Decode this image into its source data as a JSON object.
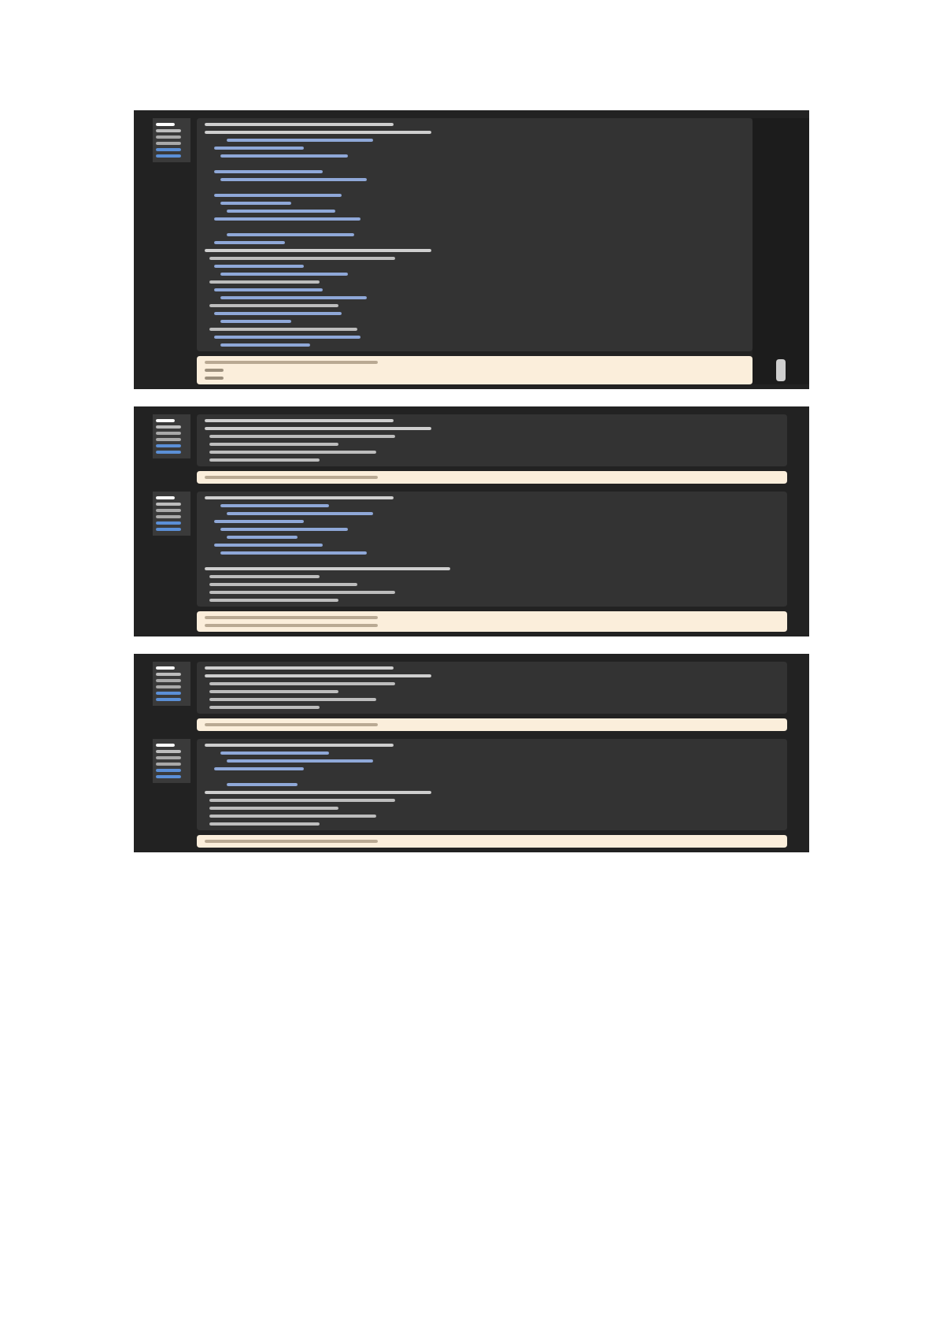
{
  "screenshots": [
    {
      "scrollbar": true,
      "questions": [
        {
          "info": [
            {
              "kind": "title"
            },
            {
              "kind": "status"
            },
            {
              "kind": "mark"
            },
            {
              "kind": "mark"
            },
            {
              "kind": "flag"
            },
            {
              "kind": "flag"
            }
          ],
          "lines": [
            {
              "kind": "text"
            },
            {
              "kind": "text"
            },
            {
              "kind": "code"
            },
            {
              "kind": "code"
            },
            {
              "kind": "code"
            },
            {
              "kind": "blank"
            },
            {
              "kind": "code"
            },
            {
              "kind": "code"
            },
            {
              "kind": "blank"
            },
            {
              "kind": "code"
            },
            {
              "kind": "code"
            },
            {
              "kind": "code"
            },
            {
              "kind": "code"
            },
            {
              "kind": "blank"
            },
            {
              "kind": "code"
            },
            {
              "kind": "code"
            },
            {
              "kind": "text"
            },
            {
              "kind": "option"
            },
            {
              "kind": "code"
            },
            {
              "kind": "code"
            },
            {
              "kind": "option"
            },
            {
              "kind": "code"
            },
            {
              "kind": "code"
            },
            {
              "kind": "option"
            },
            {
              "kind": "code"
            },
            {
              "kind": "code"
            },
            {
              "kind": "option"
            },
            {
              "kind": "code"
            },
            {
              "kind": "code"
            }
          ],
          "feedback": [
            {
              "kind": "text"
            },
            {
              "kind": "code"
            },
            {
              "kind": "code"
            }
          ]
        }
      ]
    },
    {
      "scrollbar": false,
      "questions": [
        {
          "info": [
            {
              "kind": "title"
            },
            {
              "kind": "status"
            },
            {
              "kind": "mark"
            },
            {
              "kind": "mark"
            },
            {
              "kind": "flag"
            },
            {
              "kind": "flag"
            }
          ],
          "lines": [
            {
              "kind": "text"
            },
            {
              "kind": "text"
            },
            {
              "kind": "option"
            },
            {
              "kind": "option"
            },
            {
              "kind": "option"
            },
            {
              "kind": "option"
            }
          ],
          "feedback": [
            {
              "kind": "text"
            }
          ]
        },
        {
          "info": [
            {
              "kind": "title"
            },
            {
              "kind": "status"
            },
            {
              "kind": "mark"
            },
            {
              "kind": "mark"
            },
            {
              "kind": "flag"
            },
            {
              "kind": "flag"
            }
          ],
          "lines": [
            {
              "kind": "text"
            },
            {
              "kind": "code"
            },
            {
              "kind": "code"
            },
            {
              "kind": "code"
            },
            {
              "kind": "code"
            },
            {
              "kind": "code"
            },
            {
              "kind": "code"
            },
            {
              "kind": "code"
            },
            {
              "kind": "blank"
            },
            {
              "kind": "text"
            },
            {
              "kind": "option"
            },
            {
              "kind": "option"
            },
            {
              "kind": "option"
            },
            {
              "kind": "option"
            }
          ],
          "feedback": [
            {
              "kind": "text"
            },
            {
              "kind": "text"
            }
          ]
        }
      ]
    },
    {
      "scrollbar": false,
      "questions": [
        {
          "info": [
            {
              "kind": "title"
            },
            {
              "kind": "status"
            },
            {
              "kind": "mark"
            },
            {
              "kind": "mark"
            },
            {
              "kind": "flag"
            },
            {
              "kind": "flag"
            }
          ],
          "lines": [
            {
              "kind": "text"
            },
            {
              "kind": "text"
            },
            {
              "kind": "option"
            },
            {
              "kind": "option"
            },
            {
              "kind": "option"
            },
            {
              "kind": "option"
            }
          ],
          "feedback": [
            {
              "kind": "text"
            }
          ]
        },
        {
          "info": [
            {
              "kind": "title"
            },
            {
              "kind": "status"
            },
            {
              "kind": "mark"
            },
            {
              "kind": "mark"
            },
            {
              "kind": "flag"
            },
            {
              "kind": "flag"
            }
          ],
          "lines": [
            {
              "kind": "text"
            },
            {
              "kind": "code"
            },
            {
              "kind": "code"
            },
            {
              "kind": "code"
            },
            {
              "kind": "blank"
            },
            {
              "kind": "code"
            },
            {
              "kind": "text"
            },
            {
              "kind": "option"
            },
            {
              "kind": "option"
            },
            {
              "kind": "option"
            },
            {
              "kind": "option"
            }
          ],
          "feedback": [
            {
              "kind": "text"
            }
          ]
        }
      ]
    }
  ]
}
